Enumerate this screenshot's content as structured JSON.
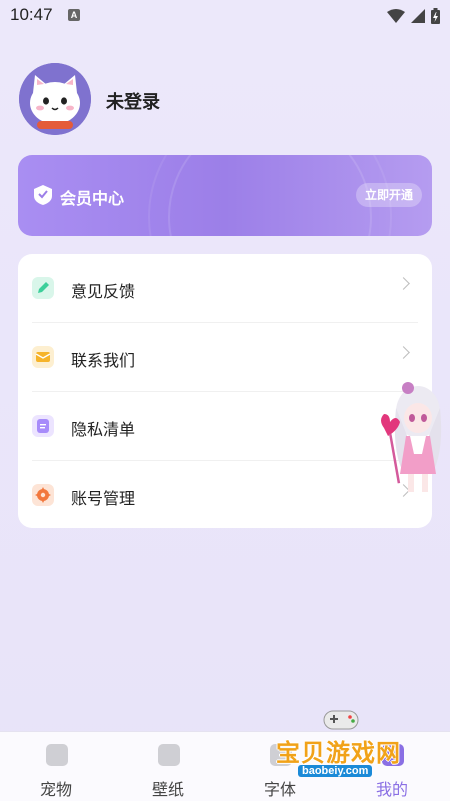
{
  "status_bar": {
    "time": "10:47",
    "notif_letter": "A"
  },
  "profile": {
    "username": "未登录"
  },
  "vip": {
    "label": "会员中心",
    "button": "立即开通",
    "accent": "#a38af0"
  },
  "menu": {
    "items": [
      {
        "label": "意见反馈",
        "icon": "pencil-icon",
        "color": "#3ccf9a"
      },
      {
        "label": "联系我们",
        "icon": "mail-icon",
        "color": "#f6b42a"
      },
      {
        "label": "隐私清单",
        "icon": "list-icon",
        "color": "#a78bfa"
      },
      {
        "label": "账号管理",
        "icon": "gear-icon",
        "color": "#f2783e"
      }
    ]
  },
  "tabs": [
    {
      "label": "宠物",
      "icon": "pet-icon",
      "active": false
    },
    {
      "label": "壁纸",
      "icon": "image-icon",
      "active": false
    },
    {
      "label": "字体",
      "icon": "font-icon",
      "active": false
    },
    {
      "label": "我的",
      "icon": "profile-icon",
      "active": true
    }
  ],
  "watermark": {
    "text": "宝贝游戏网",
    "url": "baobeiy.com"
  }
}
